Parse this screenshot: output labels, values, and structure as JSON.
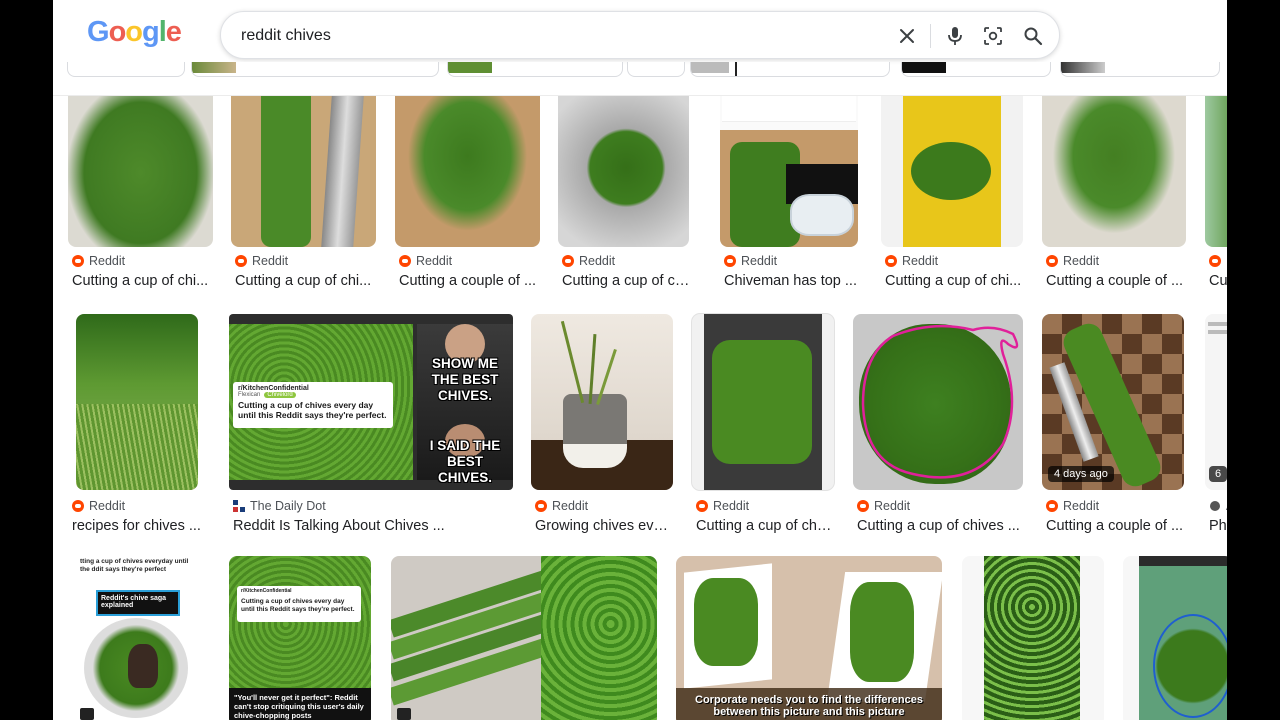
{
  "search": {
    "query": "reddit chives"
  },
  "icons": {
    "clear": "close-icon",
    "voice": "microphone-icon",
    "lens": "camera-lens-icon",
    "search": "search-icon"
  },
  "results_row1": [
    {
      "source": "Reddit",
      "title": "Cutting a cup of chi..."
    },
    {
      "source": "Reddit",
      "title": "Cutting a cup of chi..."
    },
    {
      "source": "Reddit",
      "title": "Cutting a couple of ..."
    },
    {
      "source": "Reddit",
      "title": "Cutting a cup of chi..."
    },
    {
      "source": "Reddit",
      "title": "Chiveman has top ..."
    },
    {
      "source": "Reddit",
      "title": "Cutting a cup of chi..."
    },
    {
      "source": "Reddit",
      "title": "Cutting a couple of ..."
    },
    {
      "source": "R",
      "title": "Cu"
    }
  ],
  "results_row2": [
    {
      "source": "Reddit",
      "title": "recipes for chives ..."
    },
    {
      "source": "The Daily Dot",
      "title": "Reddit Is Talking About Chives ..."
    },
    {
      "source": "Reddit",
      "title": "Growing chives eve..."
    },
    {
      "source": "Reddit",
      "title": "Cutting a cup of chi..."
    },
    {
      "source": "Reddit",
      "title": "Cutting a cup of chives ..."
    },
    {
      "source": "Reddit",
      "title": "Cutting a couple of ..."
    },
    {
      "source": "A",
      "title": "Phi"
    }
  ],
  "overlays": {
    "age_badge": "4 days ago",
    "partial_badge": "6"
  },
  "image_text": {
    "dd_post_sub": "r/KitchenConfidential",
    "dd_post_user": "Flexican",
    "dd_post_flair": "Chivelord",
    "dd_post_body": "Cutting a cup of chives every day until this Reddit says they're perfect.",
    "meme_top": "SHOW ME THE BEST CHIVES.",
    "meme_bottom": "I SAID THE BEST CHIVES.",
    "r3_caption_top": "tting a cup of chives everyday until the ddit says they're perfect",
    "r3_badge": "Reddit's chive saga explained",
    "r3b_quote": "\"You'll never get it perfect\": Reddit can't stop critiquing this user's daily chive-chopping posts",
    "r3d_caption": "Corporate needs you to find the differences between this picture and this picture"
  },
  "colors": {
    "reddit": "#ff4500",
    "chive_green": "#4a8a2a",
    "text": "#202124"
  }
}
